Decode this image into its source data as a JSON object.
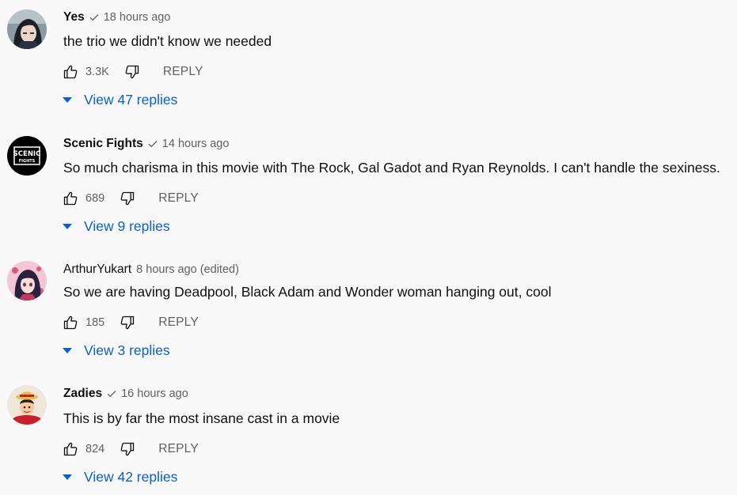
{
  "comments": [
    {
      "author": "Yes",
      "verified": true,
      "timestamp": "18 hours ago",
      "edited": "",
      "text": "the trio we didn't know we needed",
      "likes": "3.3K",
      "reply_label": "REPLY",
      "view_replies": "View 47 replies",
      "avatar_icon": "anime-character-avatar"
    },
    {
      "author": "Scenic Fights",
      "verified": true,
      "timestamp": "14 hours ago",
      "edited": "",
      "text": "So much charisma in this movie with The Rock, Gal Gadot and Ryan Reynolds. I can't handle the sexiness.",
      "likes": "689",
      "reply_label": "REPLY",
      "view_replies": "View 9 replies",
      "avatar_icon": "scenic-fights-logo-avatar",
      "avatar_logo_top": "SCENIC",
      "avatar_logo_bottom": "FIGHTS"
    },
    {
      "author": "ArthurYukart",
      "verified": false,
      "timestamp": "8 hours ago",
      "edited": "(edited)",
      "text": "So we are having Deadpool, Black Adam and Wonder woman hanging out, cool",
      "likes": "185",
      "reply_label": "REPLY",
      "view_replies": "View 3 replies",
      "avatar_icon": "anime-girl-avatar"
    },
    {
      "author": "Zadies",
      "verified": true,
      "timestamp": "16 hours ago",
      "edited": "",
      "text": "This is by far the most insane cast in a movie",
      "likes": "824",
      "reply_label": "REPLY",
      "view_replies": "View 42 replies",
      "avatar_icon": "straw-hat-pirate-avatar"
    }
  ],
  "colors": {
    "background": "#f9f9f9",
    "text_primary": "#0f0f0f",
    "text_secondary": "#606060",
    "link_blue": "#065fd4"
  }
}
